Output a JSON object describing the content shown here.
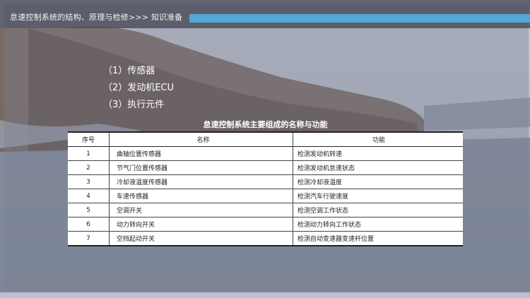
{
  "header": {
    "breadcrumb": "怠速控制系统的结构、原理与检修>>>",
    "section": "知识准备"
  },
  "components": [
    "（1）传感器",
    "（2）发动机ECU",
    "（3）执行元件"
  ],
  "table": {
    "title": "怠速控制系统主要组成的名称与功能",
    "headers": [
      "序号",
      "名称",
      "功能"
    ],
    "rows": [
      [
        "1",
        "曲轴位置传感器",
        "检测发动机转速"
      ],
      [
        "2",
        "节气门位置传感器",
        "检测发动机怠速状态"
      ],
      [
        "3",
        "冷却液温度传感器",
        "检测冷却液温度"
      ],
      [
        "4",
        "车速传感器",
        "检测汽车行驶速度"
      ],
      [
        "5",
        "空调开关",
        "检测空调工作状态"
      ],
      [
        "6",
        "动力转向开关",
        "检测动力转向工作状态"
      ],
      [
        "7",
        "空挡起动开关",
        "检测自动变速器变速杆位置"
      ]
    ]
  },
  "colors": {
    "accent": "#55a7d8",
    "topbar": "#46485a",
    "text": "#ffffff"
  }
}
